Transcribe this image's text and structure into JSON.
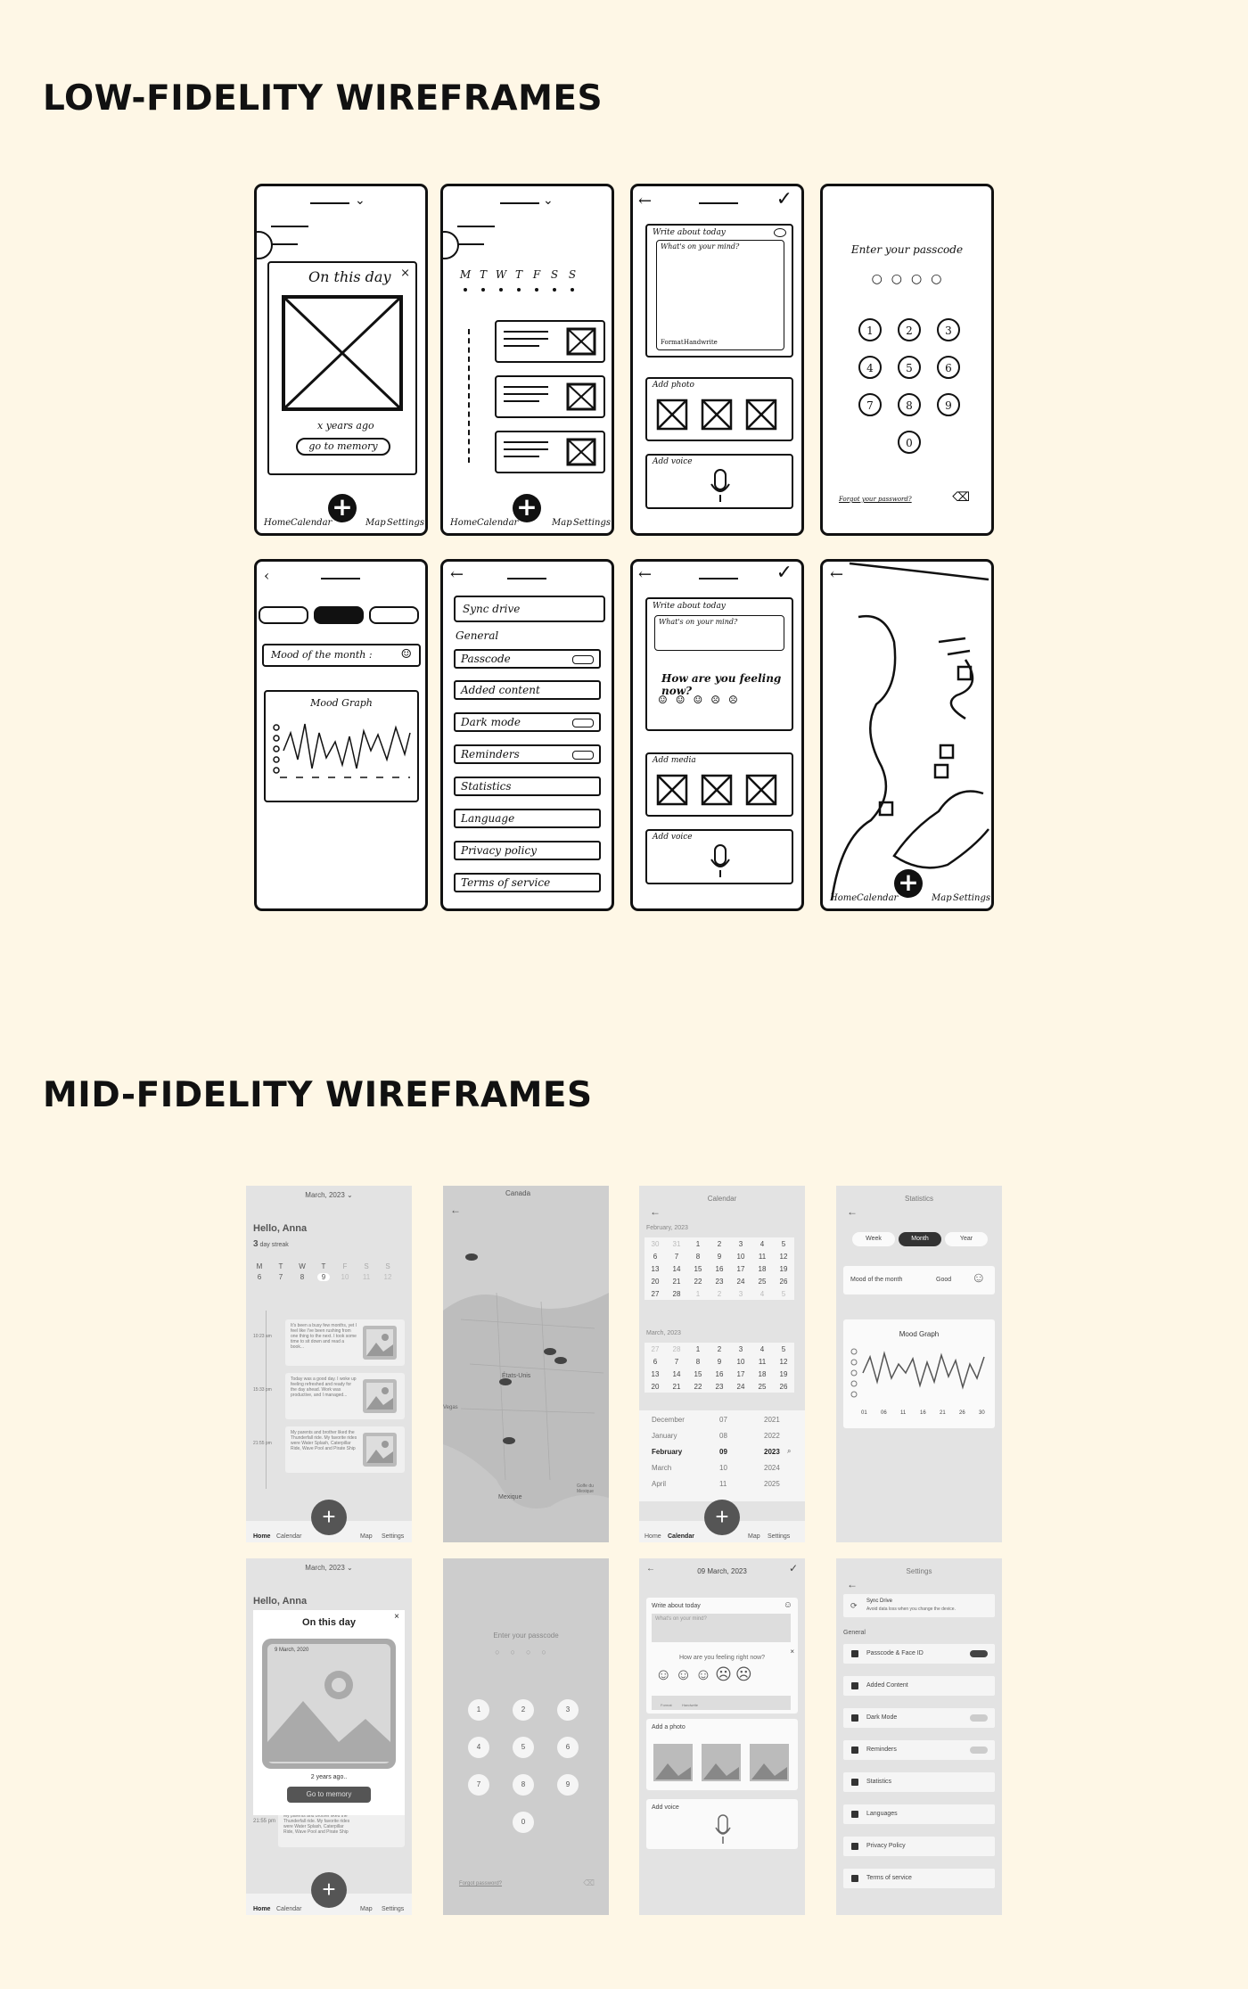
{
  "low_fi_title": "LOW-FIDELITY WIREFRAMES",
  "mid_fi_title": "MID-FIDELITY WIREFRAMES",
  "lowfi": {
    "nav": {
      "home": "Home",
      "calendar": "Calendar",
      "map": "Map",
      "settings": "Settings"
    },
    "s1": {
      "title": "On this day",
      "close": "×",
      "years_ago": "x years ago",
      "button": "go to memory"
    },
    "s2": {
      "days": [
        "M",
        "T",
        "W",
        "T",
        "F",
        "S",
        "S"
      ]
    },
    "s3": {
      "write": "Write about today",
      "mind": "What's on your mind?",
      "format": "Format",
      "handwrite": "Handwrite",
      "add_photo": "Add photo",
      "add_voice": "Add voice"
    },
    "s4": {
      "title": "Enter your passcode",
      "keys": [
        "1",
        "2",
        "3",
        "4",
        "5",
        "6",
        "7",
        "8",
        "9",
        "0"
      ],
      "forgot": "Forgot your password?"
    },
    "s5": {
      "mood": "Mood of the month :",
      "graph": "Mood Graph"
    },
    "s6": {
      "sync": "Sync drive",
      "general": "General",
      "items": [
        "Passcode",
        "Added content",
        "Dark mode",
        "Reminders",
        "Statistics",
        "Language",
        "Privacy policy",
        "Terms of service"
      ]
    },
    "s7": {
      "write": "Write about today",
      "mind": "What's on your mind?",
      "feeling": "How are you feeling now?",
      "add_media": "Add media",
      "add_voice": "Add voice"
    }
  },
  "midfi": {
    "nav": {
      "home": "Home",
      "calendar": "Calendar",
      "map": "Map",
      "settings": "Settings"
    },
    "home": {
      "month": "March, 2023",
      "hello": "Hello, Anna",
      "streak_num": "3",
      "streak": "day streak",
      "days": [
        "M",
        "T",
        "W",
        "T",
        "F",
        "S",
        "S"
      ],
      "dates": [
        "6",
        "7",
        "8",
        "9",
        "10",
        "11",
        "12"
      ],
      "entries": [
        {
          "time": "10:23 am",
          "text": "It's been a busy few months, yet I feel like I've been rushing from one thing to the next. I took some time to sit down and read a book..."
        },
        {
          "time": "15:33 pm",
          "text": "Today was a good day. I woke up feeling refreshed and ready for the day ahead. Work was productive, and I managed..."
        },
        {
          "time": "21:55 pm",
          "text": "My parents and brother liked the Thunderfall ride. My favorite rides were Water Splash, Caterpillar Ride, Wave Pool and Pirate Ship"
        }
      ]
    },
    "map": {
      "labels": [
        "Canada",
        "États-Unis",
        "Mexique",
        "Vegas",
        "Golfe du Mexique"
      ]
    },
    "calendar": {
      "title": "Calendar",
      "feb": "February, 2023",
      "mar": "March, 2023",
      "feb_rows": [
        [
          "30",
          "31",
          "1",
          "2",
          "3",
          "4",
          "5"
        ],
        [
          "6",
          "7",
          "8",
          "9",
          "10",
          "11",
          "12"
        ],
        [
          "13",
          "14",
          "15",
          "16",
          "17",
          "18",
          "19"
        ],
        [
          "20",
          "21",
          "22",
          "23",
          "24",
          "25",
          "26"
        ],
        [
          "27",
          "28",
          "1",
          "2",
          "3",
          "4",
          "5"
        ]
      ],
      "mar_rows": [
        [
          "27",
          "28",
          "1",
          "2",
          "3",
          "4",
          "5"
        ],
        [
          "6",
          "7",
          "8",
          "9",
          "10",
          "11",
          "12"
        ],
        [
          "13",
          "14",
          "15",
          "16",
          "17",
          "18",
          "19"
        ],
        [
          "20",
          "21",
          "22",
          "23",
          "24",
          "25",
          "26"
        ]
      ],
      "picker": [
        [
          "December",
          "07",
          "2021"
        ],
        [
          "January",
          "08",
          "2022"
        ],
        [
          "February",
          "09",
          "2023"
        ],
        [
          "March",
          "10",
          "2024"
        ],
        [
          "April",
          "11",
          "2025"
        ]
      ]
    },
    "stats": {
      "title": "Statistics",
      "tabs": [
        "Week",
        "Month",
        "Year"
      ],
      "mood_label": "Mood of the month",
      "mood_value": "Good",
      "graph_title": "Mood Graph",
      "x_ticks": [
        "01",
        "06",
        "11",
        "16",
        "21",
        "26",
        "30"
      ]
    },
    "onthisday": {
      "month": "March, 2023",
      "hello": "Hello, Anna",
      "title": "On this day",
      "date": "9 March, 2020",
      "ago": "2 years ago..",
      "button": "Go to memory",
      "time": "21:55 pm",
      "text": "My parents and brother liked the Thunderfall ride. My favorite rides were Water Splash, Caterpillar Ride, Wave Pool and Pirate Ship"
    },
    "passcode": {
      "title": "Enter your passcode",
      "keys": [
        "1",
        "2",
        "3",
        "4",
        "5",
        "6",
        "7",
        "8",
        "9",
        "0"
      ],
      "forgot": "Forgot password?"
    },
    "entry": {
      "date": "09 March, 2023",
      "write": "Write about today",
      "mind": "What's on your mind?",
      "feeling": "How are you feeling right now?",
      "format": "Format",
      "handwrite": "Handwrite",
      "add_photo": "Add a photo",
      "add_voice": "Add voice"
    },
    "settings": {
      "title": "Settings",
      "sync": "Sync Drive",
      "sync_sub": "Avoid data loss when you change the device.",
      "general": "General",
      "items": [
        "Passcode & Face ID",
        "Added Content",
        "Dark Mode",
        "Reminders",
        "Statistics",
        "Languages",
        "Privacy Policy",
        "Terms of service"
      ]
    }
  }
}
